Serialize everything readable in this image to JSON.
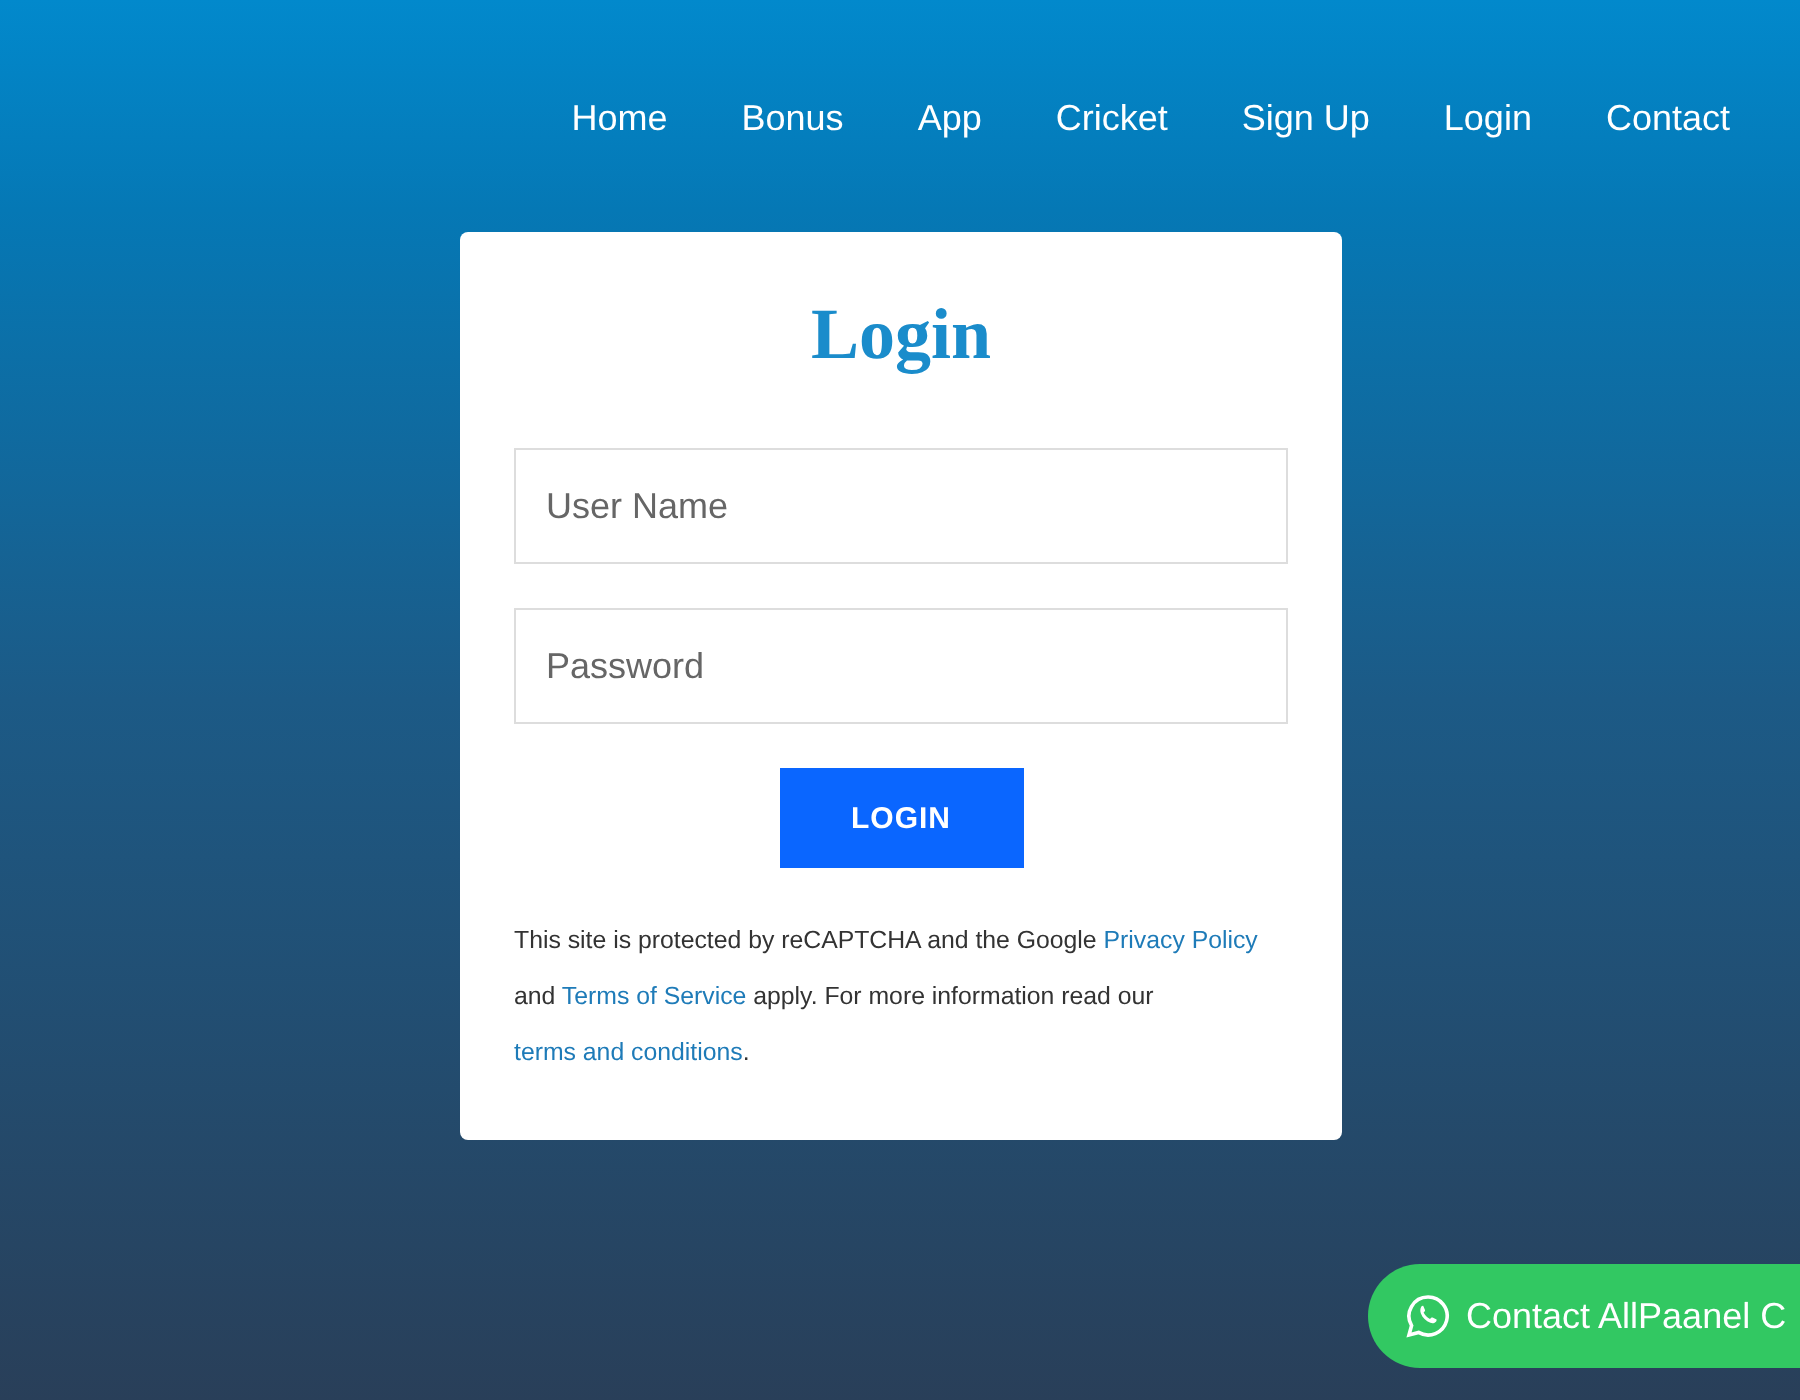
{
  "nav": [
    {
      "label": "Home"
    },
    {
      "label": "Bonus"
    },
    {
      "label": "App"
    },
    {
      "label": "Cricket"
    },
    {
      "label": "Sign Up"
    },
    {
      "label": "Login"
    },
    {
      "label": "Contact"
    }
  ],
  "login": {
    "title": "Login",
    "fields": [
      {
        "placeholder": "User Name"
      },
      {
        "placeholder": "Password"
      }
    ],
    "button": "LOGIN",
    "notice": [
      {
        "kind": "text",
        "text": "This site is protected by reCAPTCHA and the Google "
      },
      {
        "kind": "link",
        "text": "Privacy Policy"
      },
      {
        "kind": "text",
        "text": " and "
      },
      {
        "kind": "link",
        "text": "Terms of Service"
      },
      {
        "kind": "text",
        "text": " apply. For more information read our "
      },
      {
        "kind": "link",
        "text": "terms and conditions"
      },
      {
        "kind": "text",
        "text": "."
      }
    ]
  },
  "chat_button": {
    "label": "Contact AllPaanel C"
  }
}
